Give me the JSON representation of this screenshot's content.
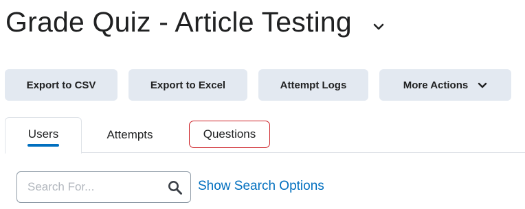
{
  "header": {
    "title": "Grade Quiz - Article Testing",
    "title_menu_icon": "chevron-down-icon"
  },
  "toolbar": {
    "export_csv_label": "Export to CSV",
    "export_excel_label": "Export to Excel",
    "attempt_logs_label": "Attempt Logs",
    "more_actions_label": "More Actions",
    "more_actions_icon": "chevron-down-icon"
  },
  "tabs": {
    "items": [
      {
        "label": "Users",
        "active": true
      },
      {
        "label": "Attempts",
        "active": false
      },
      {
        "label": "Questions",
        "active": false,
        "highlighted": true
      }
    ]
  },
  "search": {
    "value": "",
    "placeholder": "Search For...",
    "icon": "search-icon",
    "options_link": "Show Search Options"
  },
  "colors": {
    "button_bg": "#e3e9f1",
    "accent": "#006fbf",
    "highlight_border": "#cd2026",
    "text": "#202122",
    "placeholder": "#b1b6bd"
  }
}
